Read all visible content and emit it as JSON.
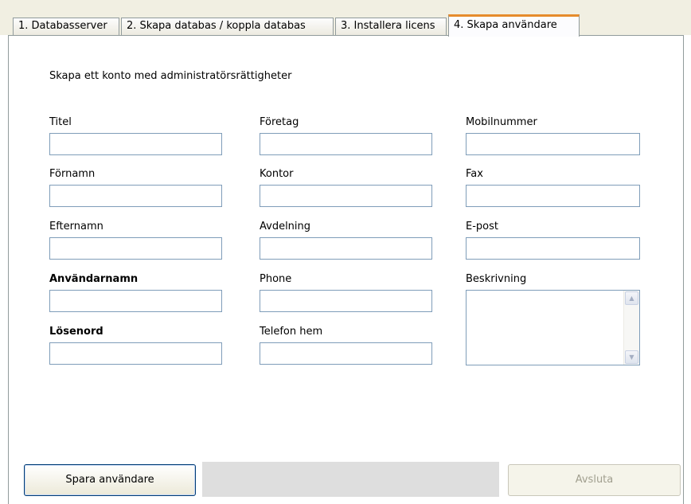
{
  "tabs": [
    {
      "label": "1. Databasserver"
    },
    {
      "label": "2. Skapa databas / koppla databas"
    },
    {
      "label": "3. Installera licens"
    },
    {
      "label": "4. Skapa användare"
    }
  ],
  "form": {
    "intro": "Skapa ett konto med administratörsrättigheter",
    "col1": [
      {
        "label": "Titel",
        "value": ""
      },
      {
        "label": "Förnamn",
        "value": ""
      },
      {
        "label": "Efternamn",
        "value": ""
      },
      {
        "label": "Användarnamn",
        "value": ""
      },
      {
        "label": "Lösenord",
        "value": ""
      }
    ],
    "col2": [
      {
        "label": "Företag",
        "value": ""
      },
      {
        "label": "Kontor",
        "value": ""
      },
      {
        "label": "Avdelning",
        "value": ""
      },
      {
        "label": "Phone",
        "value": ""
      },
      {
        "label": "Telefon hem",
        "value": ""
      }
    ],
    "col3": [
      {
        "label": "Mobilnummer",
        "value": ""
      },
      {
        "label": "Fax",
        "value": ""
      },
      {
        "label": "E-post",
        "value": ""
      },
      {
        "label": "Beskrivning",
        "value": ""
      }
    ]
  },
  "buttons": {
    "save": "Spara användare",
    "exit": "Avsluta"
  },
  "progress": {
    "value": 0
  },
  "scrollbar": {
    "up": "▲",
    "down": "▼"
  }
}
